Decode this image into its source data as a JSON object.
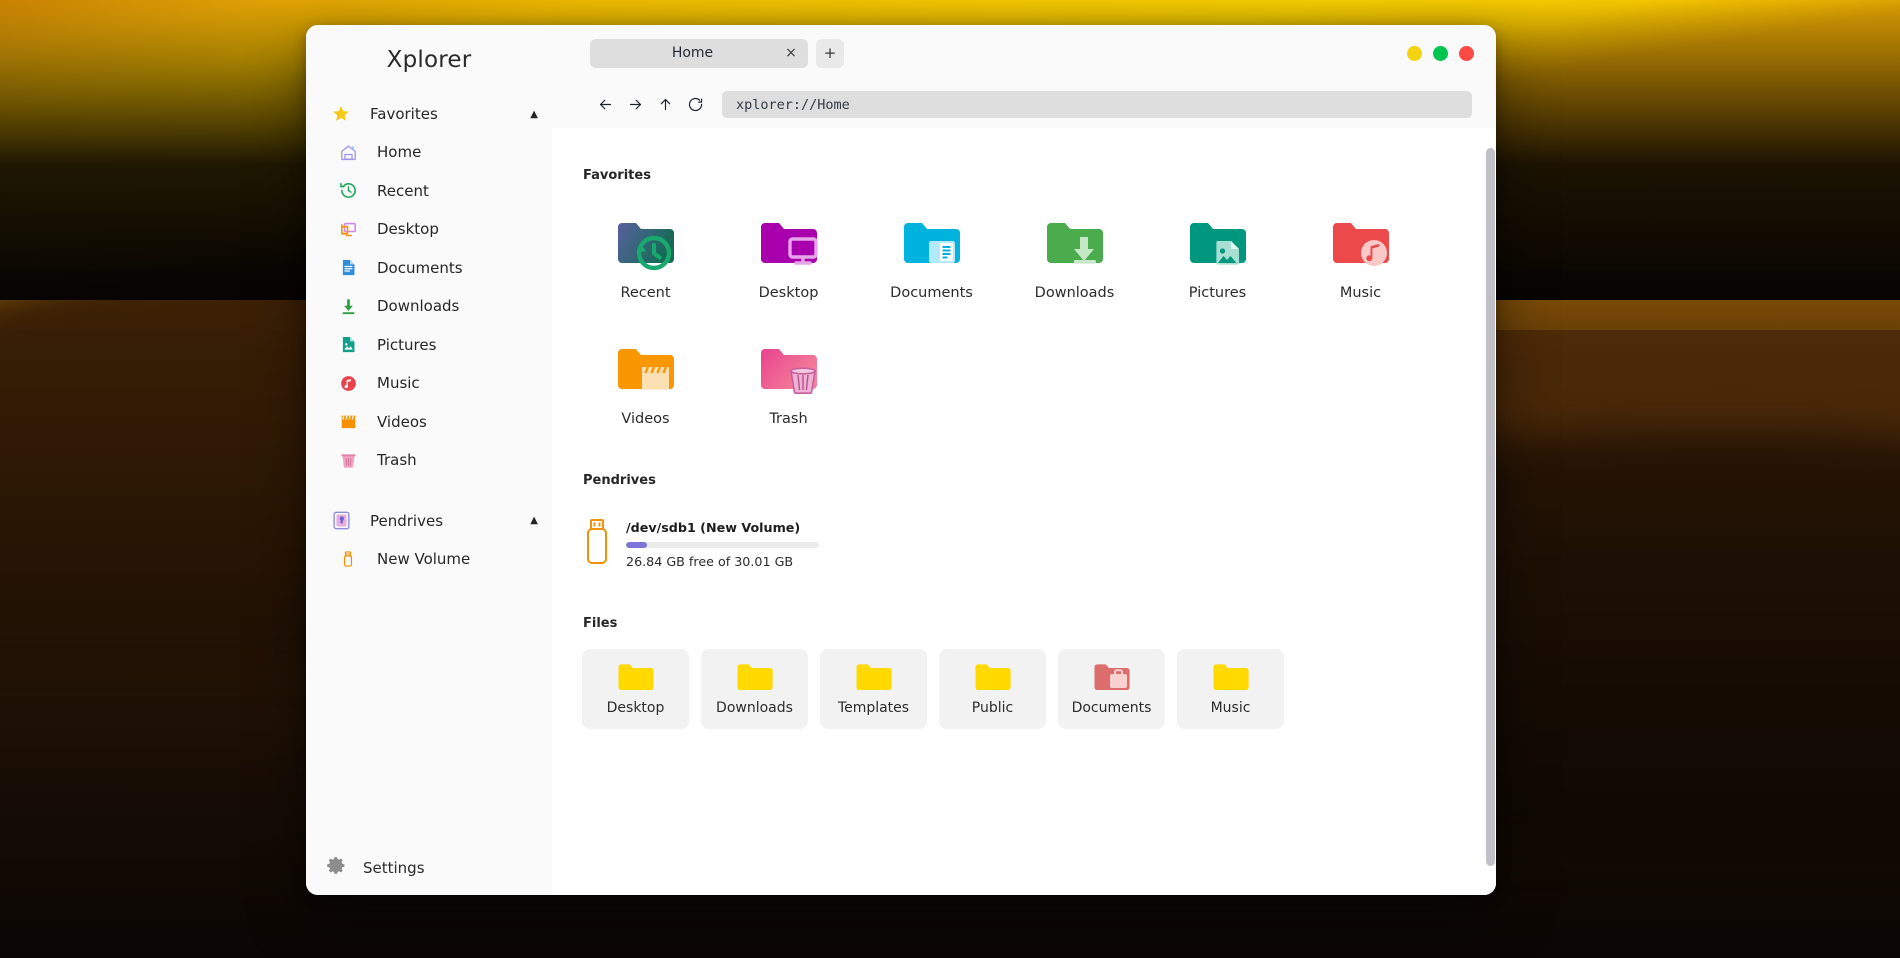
{
  "window": {
    "app_title": "Xplorer",
    "controls": [
      {
        "name": "minimize",
        "color": "#f5d312"
      },
      {
        "name": "maximize",
        "color": "#00c64f"
      },
      {
        "name": "close",
        "color": "#fe4a45"
      }
    ]
  },
  "tabs": {
    "items": [
      {
        "label": "Home",
        "close_label": "×"
      }
    ],
    "add_label": "+"
  },
  "toolbar": {
    "back_icon": "arrow-left-icon",
    "forward_icon": "arrow-right-icon",
    "up_icon": "arrow-up-icon",
    "reload_icon": "reload-icon",
    "address_value": "xplorer://Home",
    "address_placeholder": "xplorer://Home"
  },
  "sidebar": {
    "favorites_group": {
      "label": "Favorites",
      "icon": "star-icon",
      "caret": "▲"
    },
    "favorites_items": [
      {
        "label": "Home",
        "icon": "home-icon"
      },
      {
        "label": "Recent",
        "icon": "history-clock-icon"
      },
      {
        "label": "Desktop",
        "icon": "monitor-icon"
      },
      {
        "label": "Documents",
        "icon": "document-icon"
      },
      {
        "label": "Downloads",
        "icon": "download-arrow-icon"
      },
      {
        "label": "Pictures",
        "icon": "image-file-icon"
      },
      {
        "label": "Music",
        "icon": "music-note-icon"
      },
      {
        "label": "Videos",
        "icon": "clapperboard-icon"
      },
      {
        "label": "Trash",
        "icon": "trash-bin-icon"
      }
    ],
    "pendrives_group": {
      "label": "Pendrives",
      "icon": "pendrive-group-icon",
      "caret": "▲"
    },
    "pendrives_items": [
      {
        "label": "New Volume",
        "icon": "usb-stick-icon"
      }
    ],
    "settings": {
      "label": "Settings",
      "icon": "gear-icon"
    }
  },
  "main": {
    "favorites_title": "Favorites",
    "favorites": [
      {
        "label": "Recent",
        "icon": "folder-recent-icon"
      },
      {
        "label": "Desktop",
        "icon": "folder-desktop-icon"
      },
      {
        "label": "Documents",
        "icon": "folder-documents-icon"
      },
      {
        "label": "Downloads",
        "icon": "folder-downloads-icon"
      },
      {
        "label": "Pictures",
        "icon": "folder-pictures-icon"
      },
      {
        "label": "Music",
        "icon": "folder-music-icon"
      },
      {
        "label": "Videos",
        "icon": "folder-videos-icon"
      },
      {
        "label": "Trash",
        "icon": "folder-trash-icon"
      }
    ],
    "pendrives_title": "Pendrives",
    "pendrives": [
      {
        "name": "/dev/sdb1 (New Volume)",
        "free_text": "26.84 GB free of 30.01 GB",
        "used_percent": 11,
        "icon": "usb-stick-icon"
      }
    ],
    "files_title": "Files",
    "files": [
      {
        "label": "Desktop",
        "icon": "folder-yellow-icon"
      },
      {
        "label": "Downloads",
        "icon": "folder-yellow-icon"
      },
      {
        "label": "Templates",
        "icon": "folder-yellow-icon"
      },
      {
        "label": "Public",
        "icon": "folder-yellow-icon"
      },
      {
        "label": "Documents",
        "icon": "folder-red-briefcase-icon"
      },
      {
        "label": "Music",
        "icon": "folder-yellow-icon"
      }
    ]
  },
  "colors": {
    "accent_purple": "#7b76d8",
    "folder_yellow": "#ffd900",
    "window_bg": "#fafafa",
    "content_bg": "#ffffff",
    "tab_bg": "#dedede"
  }
}
